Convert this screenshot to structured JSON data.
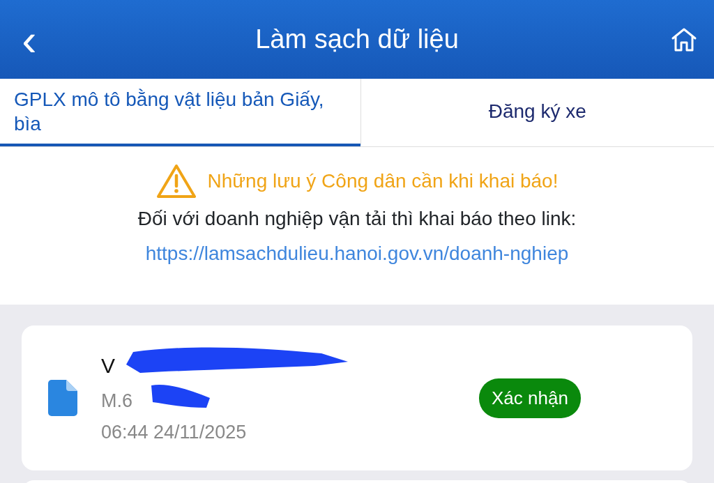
{
  "header": {
    "back_icon": "‹",
    "title": "Làm sạch dữ liệu"
  },
  "tabs": [
    {
      "label": "GPLX mô tô bằng vật liệu bản Giấy, bìa",
      "selected": true
    },
    {
      "label": "Đăng ký xe",
      "selected": false
    }
  ],
  "notice": {
    "warning": "Những lưu ý Công dân cần khi khai báo!",
    "text": "Đối với doanh nghiệp vận tải thì khai báo theo link:",
    "link": "https://lamsachdulieu.hanoi.gov.vn/doanh-nghiep"
  },
  "records": [
    {
      "title": "V",
      "code": "M.6",
      "time": "06:44 24/11/2025",
      "status": "Xác nhận",
      "redacted": true
    }
  ]
}
